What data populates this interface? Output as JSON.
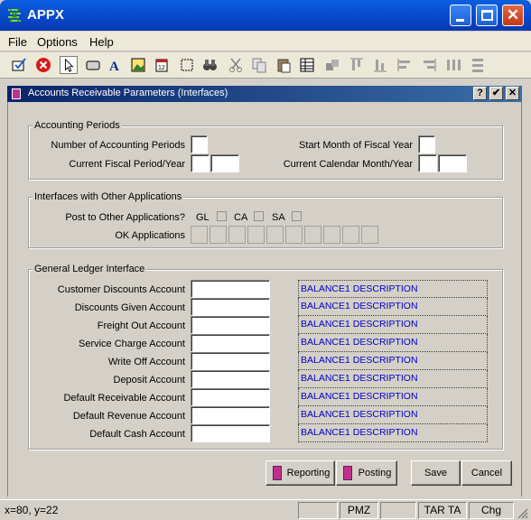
{
  "window": {
    "title": "APPX"
  },
  "menu": [
    "File",
    "Options",
    "Help"
  ],
  "toolbar": {
    "icons": [
      "edit-check-icon",
      "stop-icon",
      "pointer-icon",
      "button-icon",
      "text-icon",
      "image-icon",
      "calendar-icon",
      "frame-icon",
      "binoculars-icon",
      "cut-icon",
      "copy-icon",
      "paste-icon",
      "grid-icon",
      "align-icon",
      "align-top-icon",
      "align-bottom-icon",
      "align-left-icon",
      "align-right-icon",
      "distribute-h-icon",
      "distribute-v-icon"
    ]
  },
  "dialog": {
    "title": "Accounts Receivable Parameters (Interfaces)",
    "help": "?",
    "ok": "✔",
    "close": "✕"
  },
  "accounting_periods": {
    "label": "Accounting Periods",
    "num_periods": "Number of Accounting Periods",
    "current_fiscal": "Current Fiscal Period/Year",
    "start_month": "Start Month of Fiscal Year",
    "current_calendar": "Current Calendar Month/Year"
  },
  "interfaces": {
    "label": "Interfaces with Other Applications",
    "post_to": "Post to Other Applications?",
    "gl": "GL",
    "ca": "CA",
    "sa": "SA",
    "ok_apps": "OK Applications"
  },
  "gl_interface": {
    "label": "General Ledger Interface",
    "rows": [
      {
        "label": "Customer Discounts Account",
        "desc": "BALANCE1 DESCRIPTION"
      },
      {
        "label": "Discounts Given Account",
        "desc": "BALANCE1 DESCRIPTION"
      },
      {
        "label": "Freight Out Account",
        "desc": "BALANCE1 DESCRIPTION"
      },
      {
        "label": "Service Charge Account",
        "desc": "BALANCE1 DESCRIPTION"
      },
      {
        "label": "Write Off Account",
        "desc": "BALANCE1 DESCRIPTION"
      },
      {
        "label": "Deposit Account",
        "desc": "BALANCE1 DESCRIPTION"
      },
      {
        "label": "Default Receivable Account",
        "desc": "BALANCE1 DESCRIPTION"
      },
      {
        "label": "Default Revenue Account",
        "desc": "BALANCE1 DESCRIPTION"
      },
      {
        "label": "Default Cash Account",
        "desc": "BALANCE1 DESCRIPTION"
      }
    ]
  },
  "buttons": {
    "reporting": "Reporting",
    "posting": "Posting",
    "save": "Save",
    "cancel": "Cancel"
  },
  "status": {
    "coords": "x=80, y=22",
    "pmz": "PMZ",
    "tar": "TAR TA",
    "chg": "Chg"
  }
}
